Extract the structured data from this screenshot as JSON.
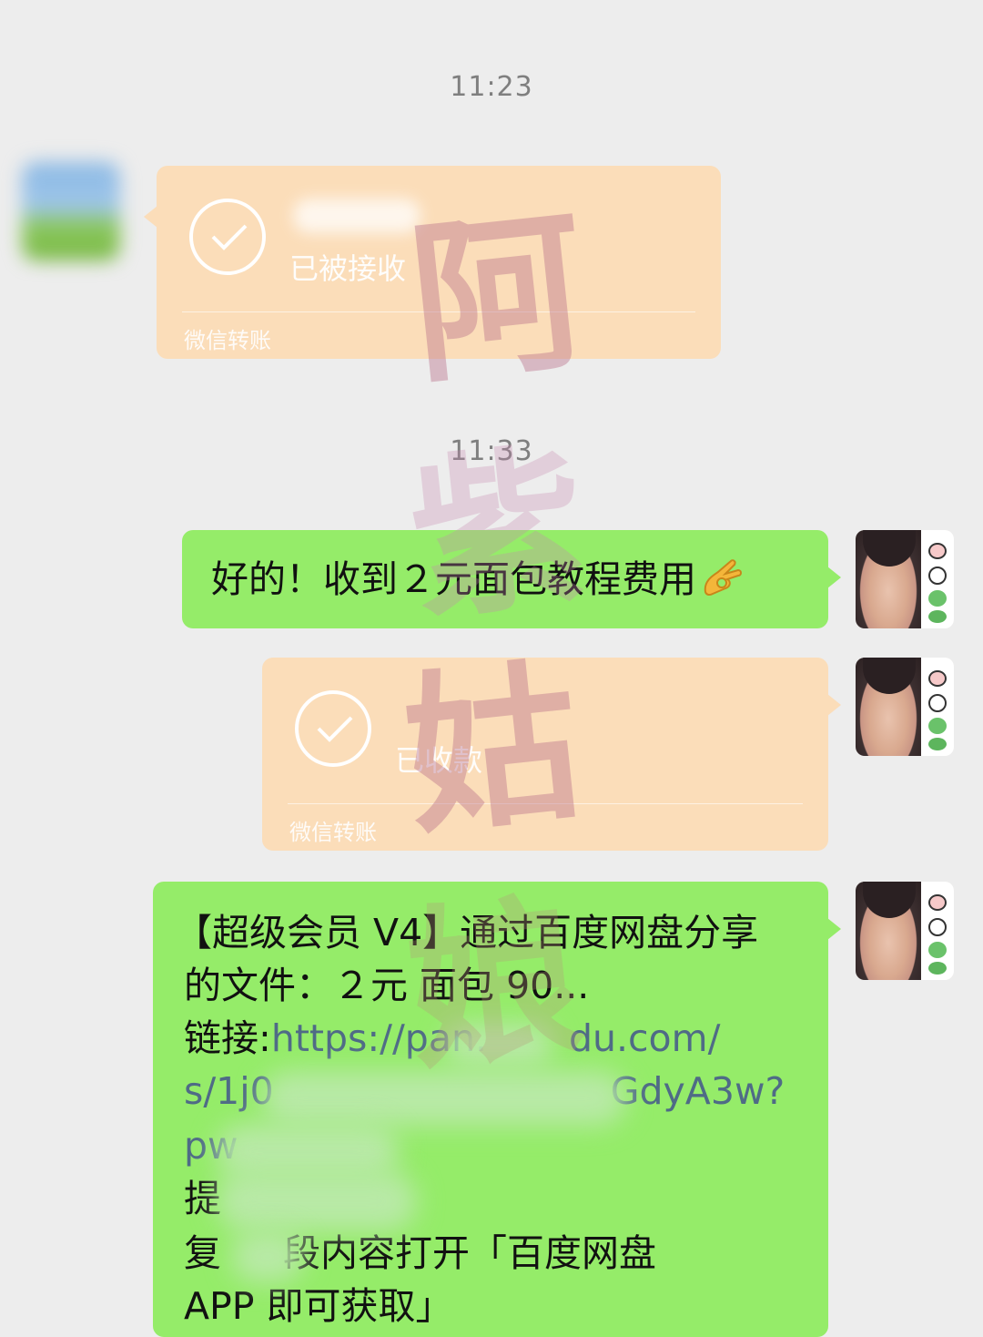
{
  "timestamps": [
    "11:23",
    "11:33"
  ],
  "transfer_received_other": {
    "status": "已被接收",
    "label": "微信转账"
  },
  "message_thanks": {
    "text": "好的！收到２元面包教程费用"
  },
  "transfer_received_self": {
    "status": "已收款",
    "label": "微信转账"
  },
  "message_share": {
    "line1": "【超级会员 V4】通过百度网盘分享",
    "line2": "的文件：２元 面包 90...",
    "line3_prefix": "链接:",
    "line3_link": "https://pan.",
    "line3_link_end": "du.com/",
    "line4_link_start": "s/1j0",
    "line4_link_end": "GdyA3w?",
    "line5": "pw",
    "line6": "提",
    "line7_a": "复",
    "line7_b": "段内容打开「百度网盘",
    "line8": "APP 即可获取」"
  },
  "watermark": {
    "chars": [
      "阿",
      "紫",
      "姑",
      "娘"
    ],
    "color": "#b9708a"
  },
  "colors": {
    "background": "#ededed",
    "bubble_green": "#95ec69",
    "bubble_transfer": "#fbddb9",
    "link": "#4f6b86"
  }
}
